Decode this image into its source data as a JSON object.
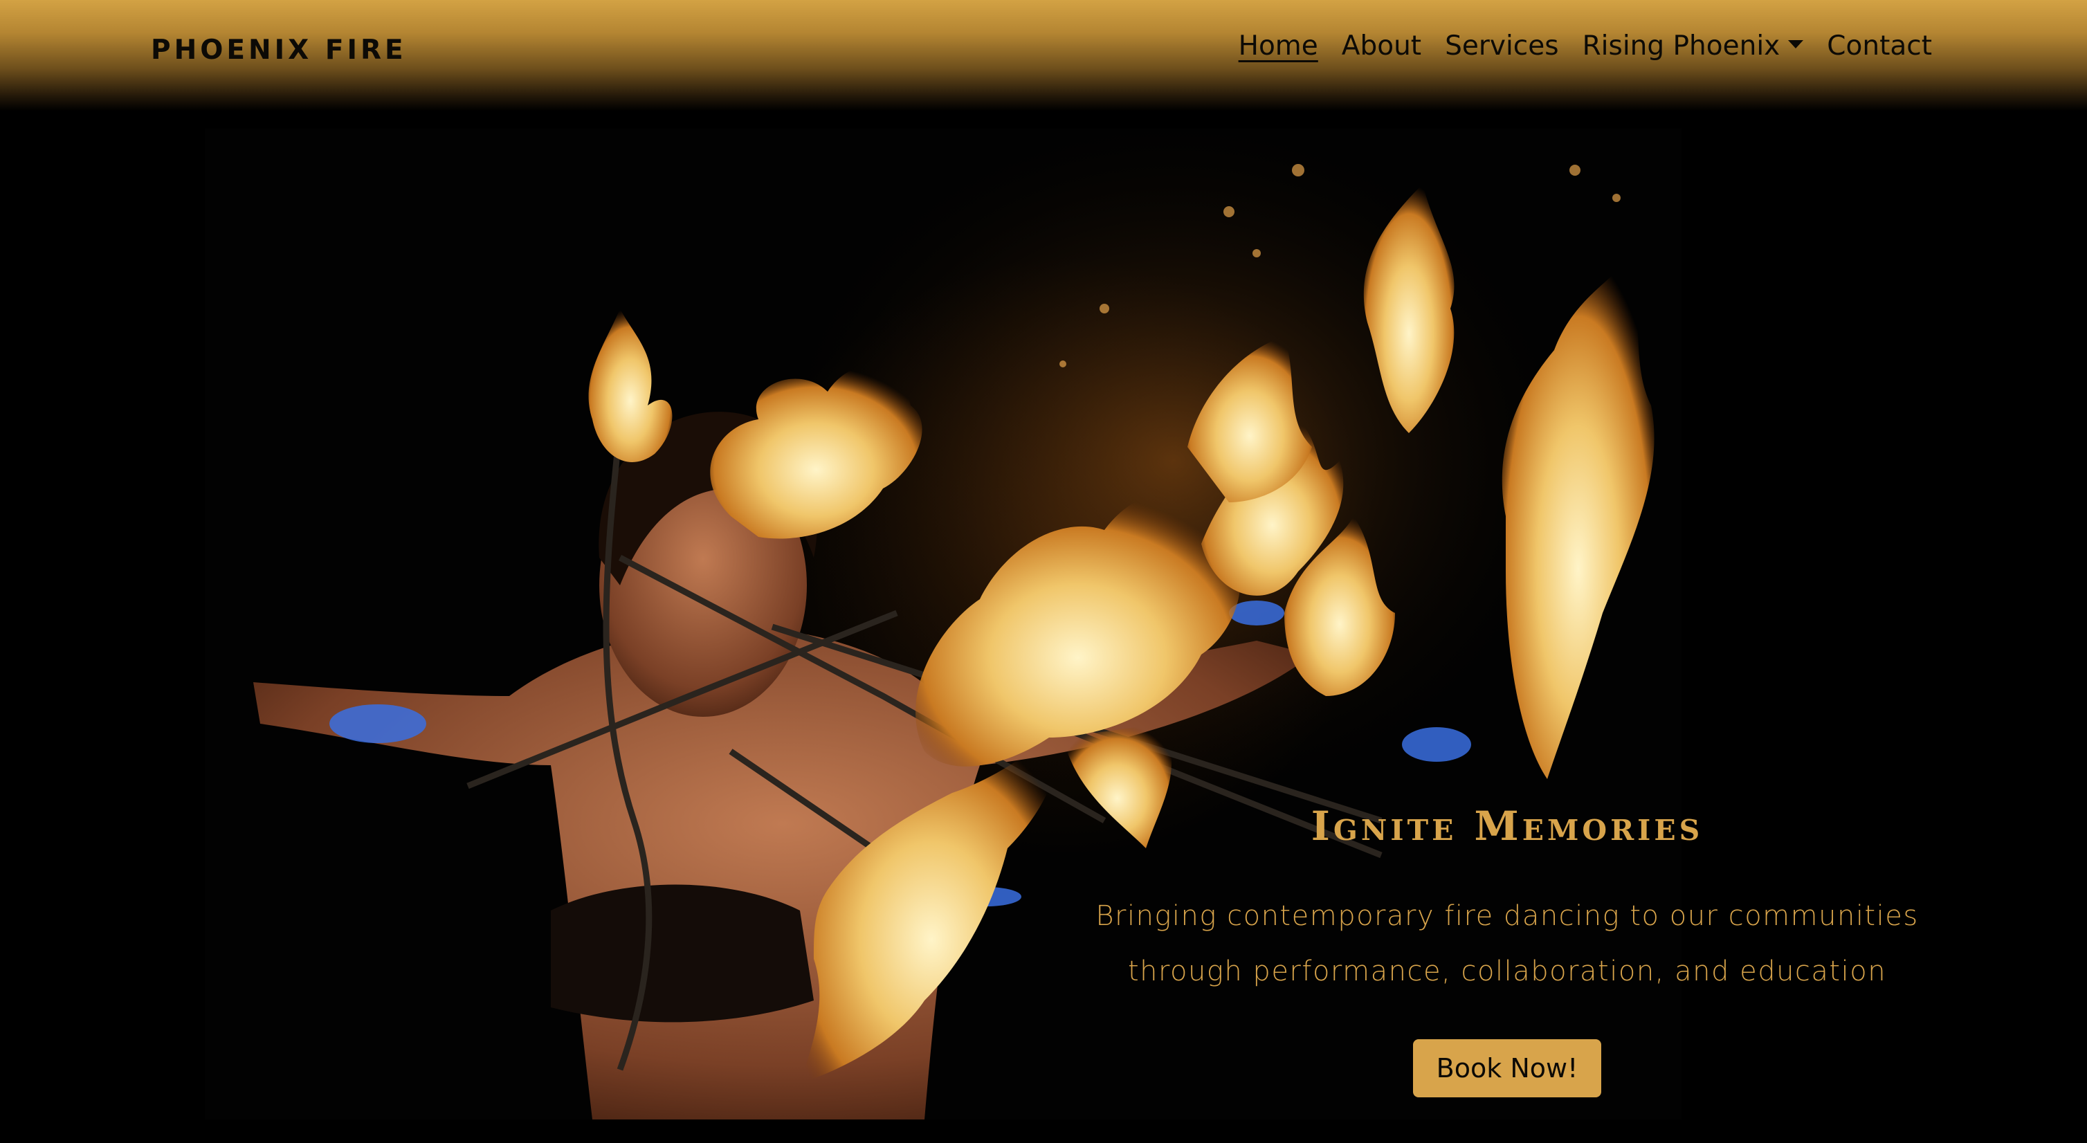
{
  "navbar": {
    "brand": "PHOENIX FIRE",
    "links": [
      {
        "label": "Home",
        "active": true
      },
      {
        "label": "About"
      },
      {
        "label": "Services"
      },
      {
        "label": "Rising Phoenix",
        "dropdown": true
      },
      {
        "label": "Contact"
      }
    ]
  },
  "hero": {
    "image_alt": "Fire dancer performing with flaming props",
    "title": "Ignite Memories",
    "subtitle_line1": "Bringing contemporary fire dancing to our communities",
    "subtitle_line2": "through performance, collaboration, and education",
    "cta_label": "Book Now!"
  },
  "colors": {
    "accent_gold": "#d8a44b",
    "navbar_gold": "#d3a244",
    "background": "#000000",
    "text_dark": "#0c0a06"
  },
  "icons": {
    "dropdown": "caret-down-icon"
  }
}
